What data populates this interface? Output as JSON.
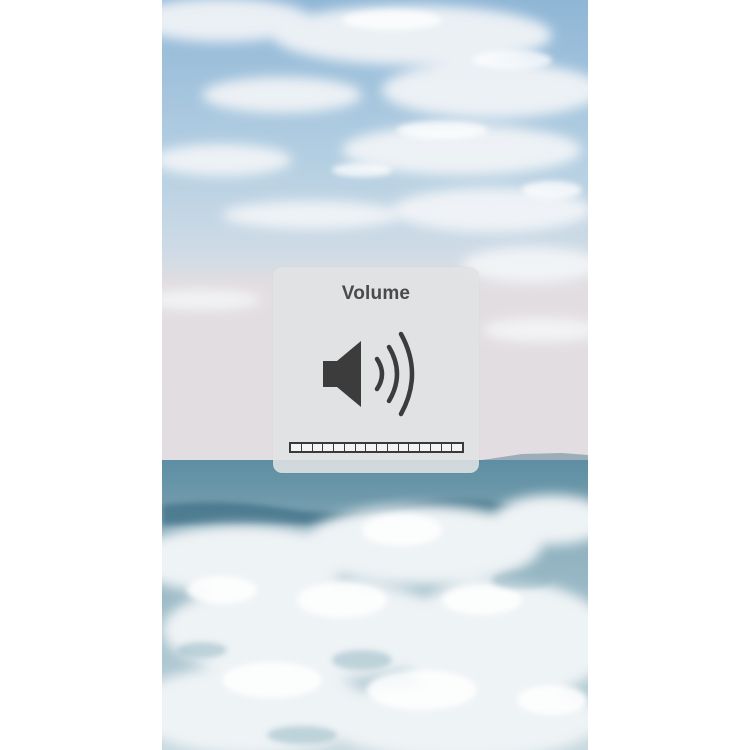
{
  "hud": {
    "title": "Volume",
    "icon": "speaker-high-volume-icon",
    "level_fraction": 1.0,
    "segments_total": 16,
    "segments_filled": 16
  },
  "wallpaper": {
    "description_colors": {
      "sky_top": "#9fc1dc",
      "sky_horizon": "#d9dde4",
      "sea": "#5f8fa3",
      "foam": "#e6eef2"
    }
  },
  "colors": {
    "hud_background": "#e0e2e4",
    "hud_text": "#4a4a4a",
    "icon": "#3c3c3c",
    "meter_border": "#3a3a3a",
    "meter_segment": "#f4f4f4"
  }
}
